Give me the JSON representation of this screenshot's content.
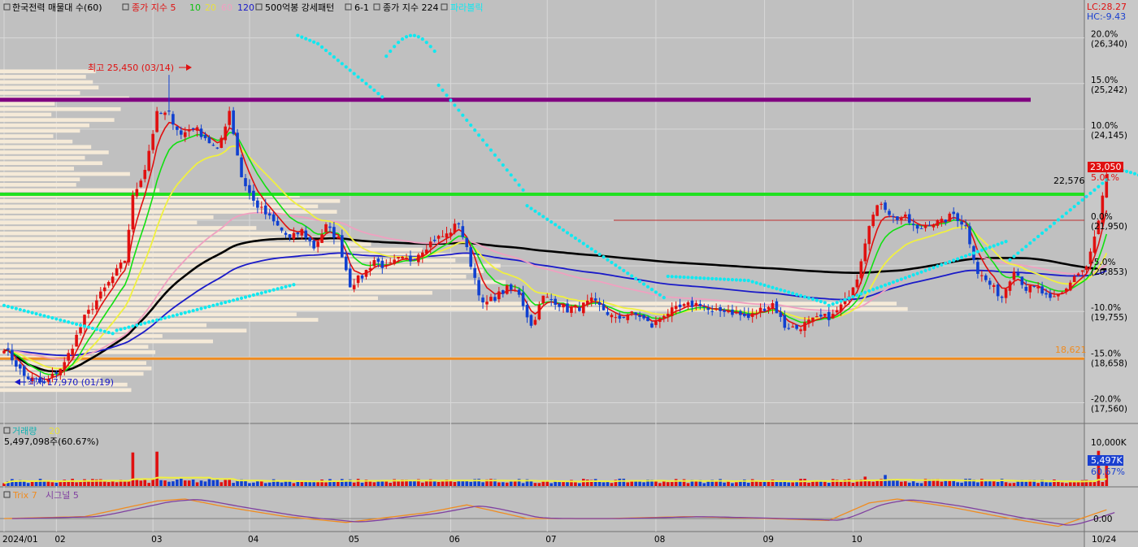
{
  "legend": {
    "stock_name": "한국전력 매물대 수(60)",
    "ma_title": "종가 지수 5",
    "ma10": "10",
    "ma20": "20",
    "ma60": "60",
    "ma120": "120",
    "pattern": "500억봉 강세패턴",
    "ratio": "6-1",
    "ma224": "종가 지수 224",
    "parabolic": "파라볼릭"
  },
  "top_right": {
    "lc": "LC:28.27",
    "hc": "HC:-9.43"
  },
  "annotations": {
    "high": "최고 25,450 (03/14)",
    "low": "최저 17,970 (01/19)",
    "green_line": "22,576",
    "orange_line": "18,621",
    "current_price": "23,050",
    "current_pct": "5.01%"
  },
  "price_axis": [
    {
      "pct": "20.0%",
      "price": "(26,340)",
      "v": 26340
    },
    {
      "pct": "15.0%",
      "price": "(25,242)",
      "v": 25242
    },
    {
      "pct": "10.0%",
      "price": "(24,145)",
      "v": 24145
    },
    {
      "pct": "0.0%",
      "price": "(21,950)",
      "v": 21950
    },
    {
      "pct": "-5.0%",
      "price": "(20,853)",
      "v": 20853
    },
    {
      "pct": "-10.0%",
      "price": "(19,755)",
      "v": 19755
    },
    {
      "pct": "-15.0%",
      "price": "(18,658)",
      "v": 18658
    },
    {
      "pct": "-20.0%",
      "price": "(17,560)",
      "v": 17560
    }
  ],
  "volume_panel": {
    "title": "거래량",
    "ma": "20",
    "value": "5,497,098주(60.67%)",
    "axis_label": "10,000K",
    "badge_value": "5,497K",
    "badge_pct": "60.67%"
  },
  "trix_panel": {
    "title": "Trix 7",
    "signal": "시그널 5",
    "axis_label": "0.00"
  },
  "x_axis": {
    "months": [
      "2024/01",
      "02",
      "03",
      "04",
      "05",
      "06",
      "07",
      "08",
      "09",
      "10"
    ],
    "last_date": "10/24"
  },
  "colors": {
    "up": "#e01010",
    "down": "#1040d0",
    "ma5": "#e01010",
    "ma10": "#10e010",
    "ma20": "#f0f040",
    "ma60": "#f0a0c0",
    "ma120": "#1a1ac8",
    "ma224": "#000000",
    "parabolic": "#10e8f0",
    "purple_line": "#800080",
    "green_line": "#20e020",
    "orange_line": "#f08c20"
  },
  "chart_data": {
    "type": "candlestick",
    "y_range": [
      17060,
      26900
    ],
    "reference_price": 21950,
    "purple_line": 24850,
    "green_line": 22576,
    "orange_line": 18621,
    "price_high": 25450,
    "price_low": 17970,
    "last_close": 23050,
    "anchors": [
      [
        0,
        18900
      ],
      [
        5,
        18200
      ],
      [
        10,
        18000
      ],
      [
        15,
        18500
      ],
      [
        20,
        19600
      ],
      [
        25,
        20300
      ],
      [
        30,
        21000
      ],
      [
        32,
        22500
      ],
      [
        35,
        23200
      ],
      [
        38,
        24500
      ],
      [
        41,
        24500
      ],
      [
        44,
        24000
      ],
      [
        47,
        24200
      ],
      [
        50,
        23950
      ],
      [
        53,
        23600
      ],
      [
        56,
        24600
      ],
      [
        59,
        23000
      ],
      [
        62,
        22400
      ],
      [
        65,
        22100
      ],
      [
        68,
        21800
      ],
      [
        71,
        21500
      ],
      [
        74,
        21700
      ],
      [
        77,
        21300
      ],
      [
        80,
        21800
      ],
      [
        83,
        21500
      ],
      [
        86,
        20400
      ],
      [
        89,
        20600
      ],
      [
        92,
        21000
      ],
      [
        95,
        20800
      ],
      [
        98,
        21000
      ],
      [
        101,
        21000
      ],
      [
        104,
        21250
      ],
      [
        107,
        21500
      ],
      [
        110,
        21600
      ],
      [
        113,
        21900
      ],
      [
        116,
        20900
      ],
      [
        119,
        19900
      ],
      [
        122,
        20100
      ],
      [
        125,
        20300
      ],
      [
        128,
        20200
      ],
      [
        131,
        19400
      ],
      [
        134,
        20100
      ],
      [
        137,
        20000
      ],
      [
        140,
        19800
      ],
      [
        143,
        19850
      ],
      [
        146,
        20000
      ],
      [
        149,
        19800
      ],
      [
        152,
        19550
      ],
      [
        155,
        19700
      ],
      [
        158,
        19650
      ],
      [
        161,
        19400
      ],
      [
        164,
        19700
      ],
      [
        167,
        19800
      ],
      [
        170,
        19900
      ],
      [
        173,
        19950
      ],
      [
        176,
        19700
      ],
      [
        179,
        19800
      ],
      [
        182,
        19700
      ],
      [
        185,
        19600
      ],
      [
        188,
        19800
      ],
      [
        191,
        19950
      ],
      [
        194,
        19400
      ],
      [
        197,
        19350
      ],
      [
        200,
        19500
      ],
      [
        203,
        19600
      ],
      [
        206,
        19650
      ],
      [
        209,
        20000
      ],
      [
        212,
        20600
      ],
      [
        215,
        21900
      ],
      [
        218,
        22400
      ],
      [
        221,
        22000
      ],
      [
        224,
        22000
      ],
      [
        227,
        21700
      ],
      [
        230,
        21900
      ],
      [
        233,
        21900
      ],
      [
        236,
        22100
      ],
      [
        239,
        21800
      ],
      [
        242,
        20700
      ],
      [
        245,
        20400
      ],
      [
        248,
        20100
      ],
      [
        251,
        20800
      ],
      [
        254,
        20300
      ],
      [
        257,
        20300
      ],
      [
        260,
        20000
      ],
      [
        263,
        20200
      ],
      [
        266,
        20600
      ],
      [
        269,
        20800
      ],
      [
        272,
        21900
      ],
      [
        274,
        23050
      ]
    ],
    "volume_max": 13500,
    "volume_spikes": [
      [
        32,
        8200
      ],
      [
        38,
        8400
      ],
      [
        214,
        2300
      ],
      [
        219,
        2700
      ],
      [
        272,
        8600
      ],
      [
        274,
        5497
      ]
    ],
    "trix_anchors": [
      [
        0,
        0
      ],
      [
        20,
        0.1
      ],
      [
        38,
        0.9
      ],
      [
        45,
        1.0
      ],
      [
        55,
        0.6
      ],
      [
        70,
        0.1
      ],
      [
        85,
        -0.2
      ],
      [
        105,
        0.3
      ],
      [
        115,
        0.7
      ],
      [
        130,
        0.0
      ],
      [
        150,
        0.0
      ],
      [
        170,
        0.1
      ],
      [
        190,
        0.0
      ],
      [
        205,
        -0.1
      ],
      [
        215,
        0.8
      ],
      [
        222,
        1.0
      ],
      [
        235,
        0.6
      ],
      [
        250,
        0.0
      ],
      [
        262,
        -0.4
      ],
      [
        274,
        0.45
      ]
    ]
  }
}
